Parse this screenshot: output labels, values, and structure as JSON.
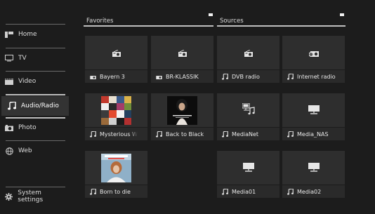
{
  "sidebar": {
    "items": [
      {
        "label": "Home",
        "icon": "home-icon"
      },
      {
        "label": "TV",
        "icon": "tv-icon"
      },
      {
        "label": "Video",
        "icon": "video-icon"
      },
      {
        "label": "Audio/Radio",
        "icon": "music-note-icon",
        "active": true
      },
      {
        "label": "Photo",
        "icon": "camera-icon"
      },
      {
        "label": "Web",
        "icon": "globe-icon"
      }
    ],
    "settings_label": "System settings"
  },
  "sections": {
    "favorites_title": "Favorites",
    "sources_title": "Sources"
  },
  "tiles": [
    {
      "label": "Bayern 3",
      "label_icon": "radio-icon",
      "art_icon": "radio-icon"
    },
    {
      "label": "BR-KLASSIK",
      "label_icon": "radio-icon",
      "art_icon": "radio-icon"
    },
    {
      "label": "DVB radio",
      "label_icon": "music-note-icon",
      "art_icon": "radio-icon"
    },
    {
      "label": "Internet radio",
      "label_icon": "music-note-icon",
      "art_icon": "internet-radio-icon"
    },
    {
      "label": "Mysterious W",
      "label_icon": "music-note-icon",
      "art_icon": "album-cover-collage"
    },
    {
      "label": "Back to Black",
      "label_icon": "music-note-icon",
      "art_icon": "album-cover-back-to-black"
    },
    {
      "label": "MediaNet",
      "label_icon": "music-note-icon",
      "art_icon": "media-network-icon"
    },
    {
      "label": "Media_NAS",
      "label_icon": "music-note-icon",
      "art_icon": "nas-server-icon"
    },
    {
      "label": "Born to die",
      "label_icon": "music-note-icon",
      "art_icon": "album-cover-born-to-die"
    },
    {
      "label": "Media01",
      "label_icon": "music-note-icon",
      "art_icon": "nas-server-icon"
    },
    {
      "label": "Media02",
      "label_icon": "music-note-icon",
      "art_icon": "nas-server-icon"
    }
  ],
  "colors": {
    "background": "#1c1c1c",
    "tile": "#2e2e2e",
    "active_nav": "#333333",
    "text": "#e6e6e6"
  }
}
